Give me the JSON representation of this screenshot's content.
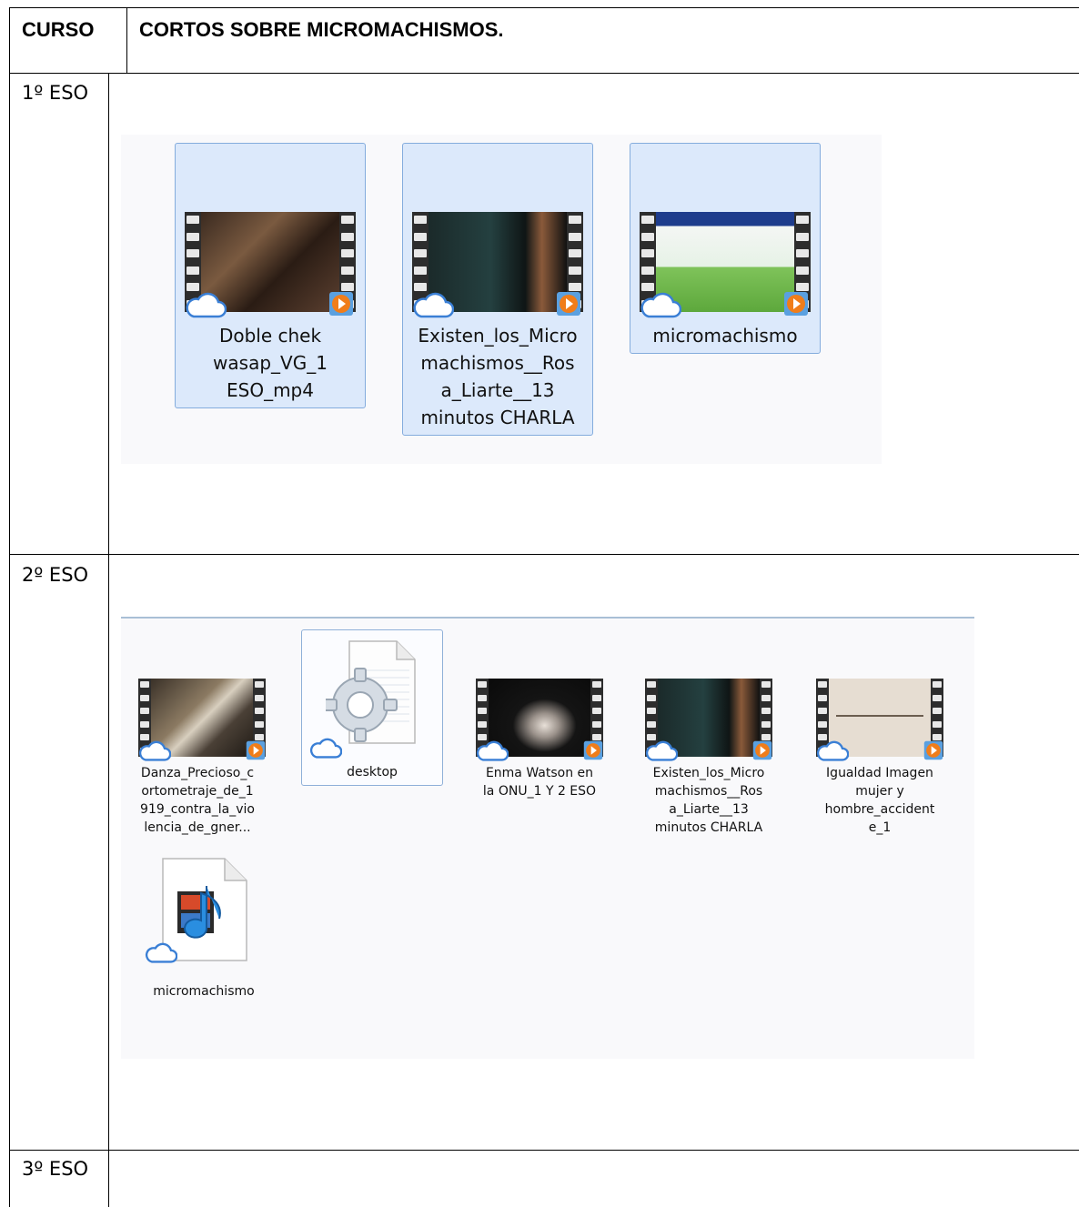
{
  "header": {
    "col1": "CURSO",
    "col2": "CORTOS SOBRE MICROMACHISMOS."
  },
  "rows": [
    {
      "course": "1º ESO",
      "files": [
        {
          "label": [
            "Doble chek",
            "wasap_VG_1",
            "ESO_mp4"
          ],
          "icon": "video-thumbnail-icon"
        },
        {
          "label": [
            "Existen_los_Micro",
            "machismos__Ros",
            "a_Liarte__13",
            "minutos CHARLA"
          ],
          "icon": "video-thumbnail-icon"
        },
        {
          "label": [
            "micromachismo"
          ],
          "icon": "video-thumbnail-icon"
        }
      ]
    },
    {
      "course": "2º ESO",
      "files": [
        {
          "label": [
            "Danza_Precioso_c",
            "ortometraje_de_1",
            "919_contra_la_vio",
            "lencia_de_gner..."
          ],
          "icon": "video-thumbnail-icon"
        },
        {
          "label": [
            "desktop"
          ],
          "icon": "settings-file-icon"
        },
        {
          "label": [
            "Enma Watson en",
            "la ONU_1 Y 2 ESO"
          ],
          "icon": "video-thumbnail-icon"
        },
        {
          "label": [
            "Existen_los_Micro",
            "machismos__Ros",
            "a_Liarte__13",
            "minutos CHARLA"
          ],
          "icon": "video-thumbnail-icon"
        },
        {
          "label": [
            "Igualdad Imagen",
            "mujer y",
            "hombre_accident",
            "e_1"
          ],
          "icon": "video-thumbnail-icon"
        },
        {
          "label": [
            "micromachismo"
          ],
          "icon": "media-file-icon"
        }
      ]
    },
    {
      "course": "3º ESO",
      "files": []
    }
  ],
  "colors": {
    "selection": "#dce9fb",
    "selection_border": "#84acdd",
    "cloud": "#3a7fd5",
    "play": "#f07d1a"
  }
}
